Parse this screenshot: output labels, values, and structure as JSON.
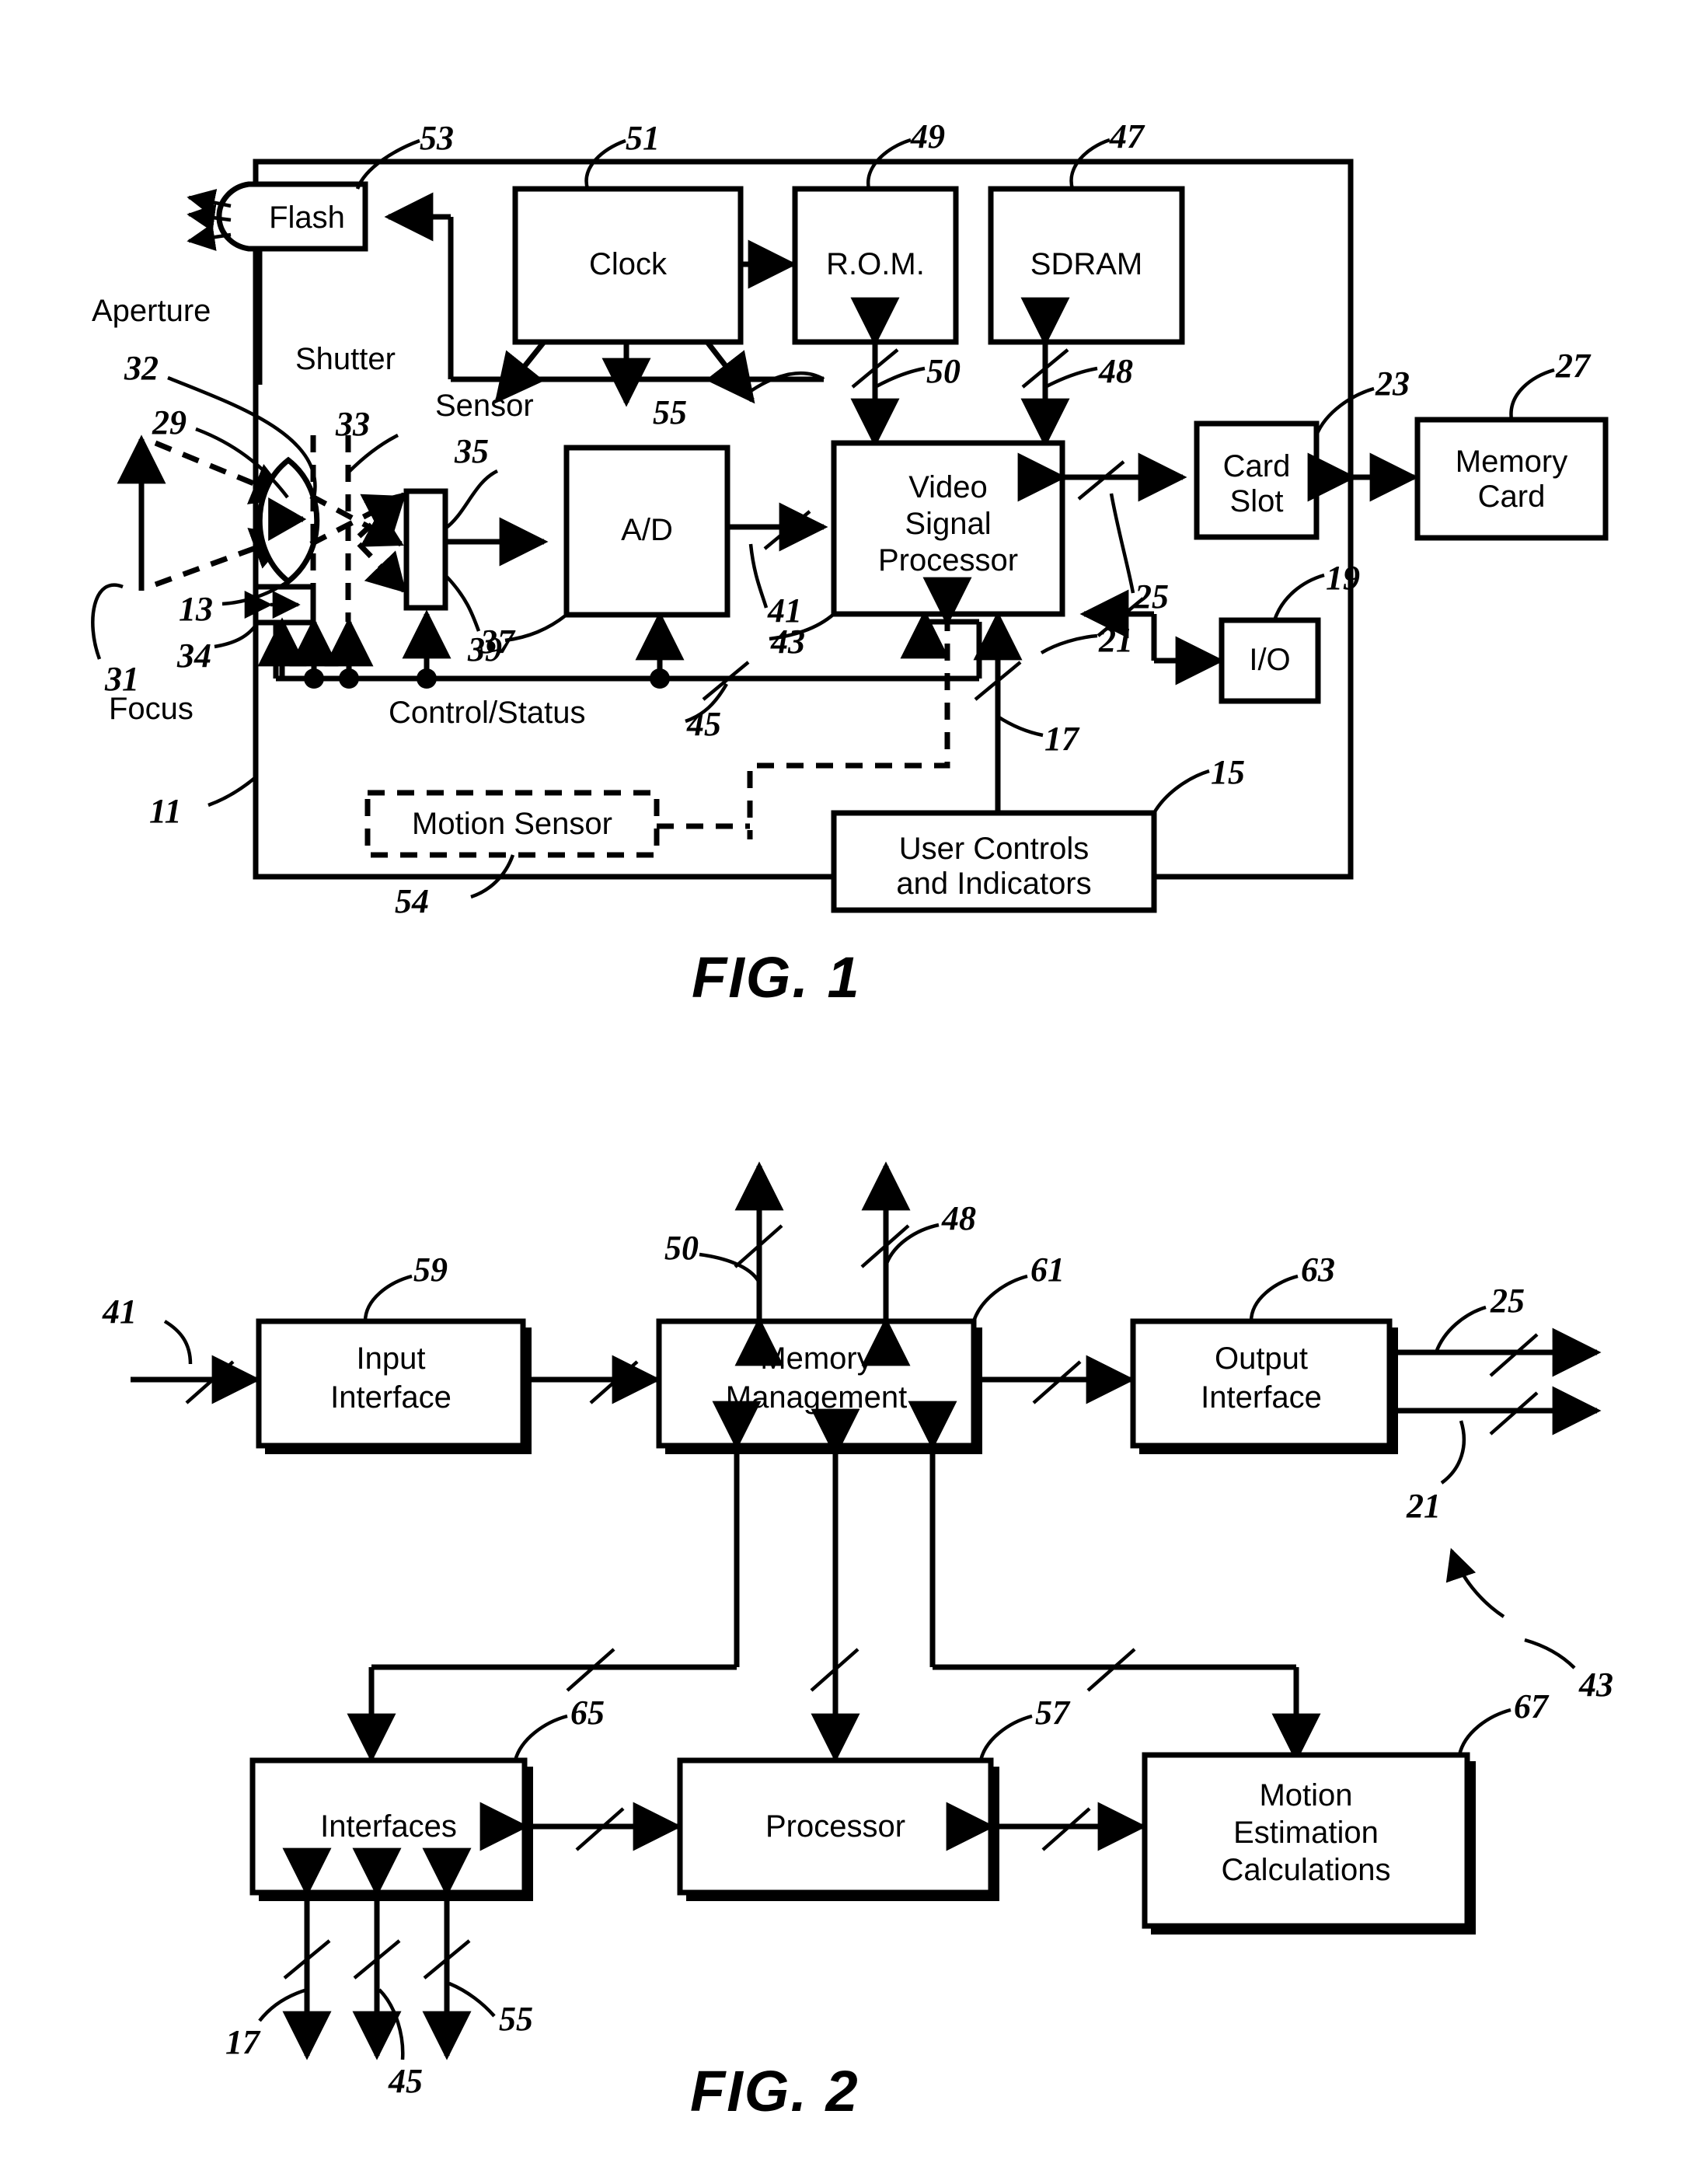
{
  "document": {
    "type": "patent-drawing-sheet",
    "figures": [
      {
        "caption": "FIG. 1",
        "title_free_labels": [
          "Aperture",
          "Shutter",
          "Sensor",
          "Focus",
          "Control/Status"
        ],
        "blocks": [
          {
            "id": "flash",
            "label": "Flash",
            "ref": "53"
          },
          {
            "id": "clock",
            "label": "Clock",
            "ref": "51"
          },
          {
            "id": "rom",
            "label": "R.O.M.",
            "ref": "49"
          },
          {
            "id": "sdram",
            "label": "SDRAM",
            "ref": "47"
          },
          {
            "id": "ad",
            "label": "A/D",
            "ref": "39"
          },
          {
            "id": "vsp",
            "label": "Video\nSignal\nProcessor",
            "ref": "43"
          },
          {
            "id": "cardslot",
            "label": "Card\nSlot",
            "ref": "23"
          },
          {
            "id": "memcard",
            "label": "Memory\nCard",
            "ref": "27"
          },
          {
            "id": "io",
            "label": "I/O",
            "ref": "19"
          },
          {
            "id": "motion",
            "label": "Motion Sensor",
            "ref": "54",
            "style": "dashed"
          },
          {
            "id": "user",
            "label": "User Controls\nand Indicators",
            "ref": "15"
          }
        ],
        "reference_numerals": [
          "53",
          "51",
          "49",
          "47",
          "32",
          "29",
          "33",
          "35",
          "55",
          "23",
          "27",
          "31",
          "13",
          "34",
          "37",
          "39",
          "41",
          "50",
          "48",
          "25",
          "19",
          "43",
          "45",
          "21",
          "17",
          "15",
          "54",
          "11"
        ]
      },
      {
        "caption": "FIG. 2",
        "blocks": [
          {
            "id": "input",
            "label": "Input\nInterface",
            "ref": "59"
          },
          {
            "id": "memmgmt",
            "label": "Memory\nManagement",
            "ref": "61"
          },
          {
            "id": "output",
            "label": "Output\nInterface",
            "ref": "63"
          },
          {
            "id": "ifaces",
            "label": "Interfaces",
            "ref": "65"
          },
          {
            "id": "proc",
            "label": "Processor",
            "ref": "57"
          },
          {
            "id": "motionest",
            "label": "Motion\nEstimation\nCalculations",
            "ref": "67"
          }
        ],
        "reference_numerals": [
          "41",
          "59",
          "50",
          "48",
          "61",
          "63",
          "25",
          "21",
          "43",
          "65",
          "57",
          "67",
          "17",
          "45",
          "55"
        ]
      }
    ]
  },
  "fig1": {
    "caption": "FIG. 1",
    "labels": {
      "flash": "Flash",
      "clock": "Clock",
      "rom": "R.O.M.",
      "sdram": "SDRAM",
      "ad": "A/D",
      "vsp_line1": "Video",
      "vsp_line2": "Signal",
      "vsp_line3": "Processor",
      "card_line1": "Card",
      "card_line2": "Slot",
      "mem_line1": "Memory",
      "mem_line2": "Card",
      "io": "I/O",
      "motion_sensor": "Motion Sensor",
      "user_line1": "User Controls",
      "user_line2": "and Indicators",
      "aperture": "Aperture",
      "shutter": "Shutter",
      "sensor": "Sensor",
      "focus": "Focus",
      "control_status": "Control/Status"
    },
    "refs": {
      "r53": "53",
      "r51": "51",
      "r49": "49",
      "r47": "47",
      "r32": "32",
      "r29": "29",
      "r33": "33",
      "r35": "35",
      "r55": "55",
      "r23": "23",
      "r27": "27",
      "r31": "31",
      "r13": "13",
      "r34": "34",
      "r37": "37",
      "r39": "39",
      "r41": "41",
      "r50": "50",
      "r48": "48",
      "r25": "25",
      "r19": "19",
      "r43": "43",
      "r45": "45",
      "r21": "21",
      "r17": "17",
      "r15": "15",
      "r54": "54",
      "r11": "11"
    }
  },
  "fig2": {
    "caption": "FIG. 2",
    "labels": {
      "input_line1": "Input",
      "input_line2": "Interface",
      "mem_line1": "Memory",
      "mem_line2": "Management",
      "output_line1": "Output",
      "output_line2": "Interface",
      "interfaces": "Interfaces",
      "processor": "Processor",
      "me_line1": "Motion",
      "me_line2": "Estimation",
      "me_line3": "Calculations"
    },
    "refs": {
      "r41": "41",
      "r59": "59",
      "r50": "50",
      "r48": "48",
      "r61": "61",
      "r63": "63",
      "r25": "25",
      "r21": "21",
      "r43": "43",
      "r65": "65",
      "r57": "57",
      "r67": "67",
      "r17": "17",
      "r45": "45",
      "r55": "55"
    }
  },
  "colors": {
    "ink": "#000000",
    "paper": "#ffffff"
  }
}
